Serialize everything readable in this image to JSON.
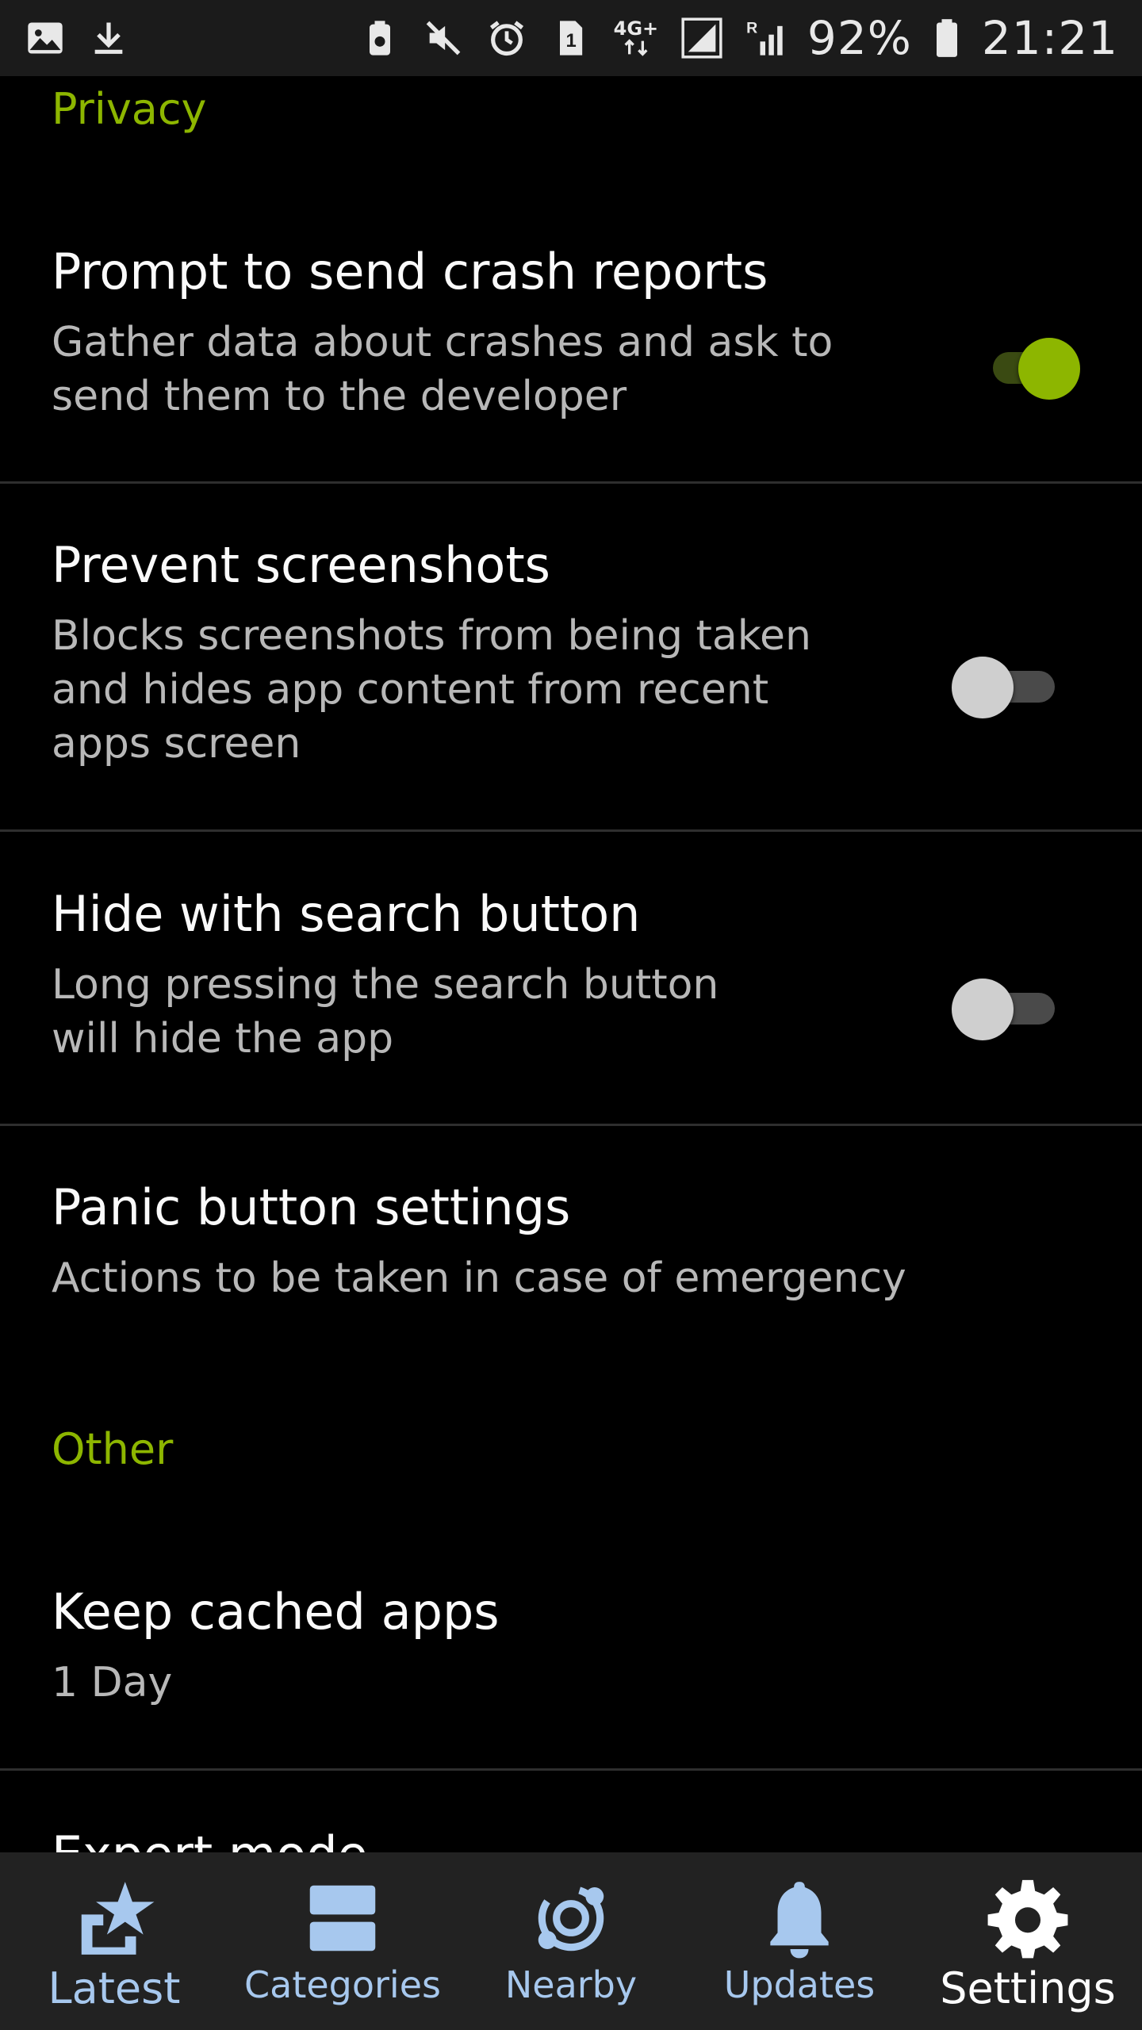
{
  "status_bar": {
    "battery_percent": "92%",
    "time": "21:21",
    "sim_number": "1",
    "network_type": "4G+",
    "roaming": "R",
    "icons": [
      "image-icon",
      "download-icon",
      "battery-saver-icon",
      "mute-icon",
      "alarm-icon",
      "sim-icon",
      "data-arrows-icon",
      "signal-icon",
      "signal-roaming-icon",
      "battery-icon"
    ]
  },
  "sections": {
    "privacy": {
      "header": "Privacy"
    },
    "other": {
      "header": "Other"
    }
  },
  "prefs": {
    "crash_reports": {
      "title": "Prompt to send crash reports",
      "summary": "Gather data about crashes and ask to\nsend them to the developer",
      "enabled": true
    },
    "prevent_screenshots": {
      "title": "Prevent screenshots",
      "summary": "Blocks screenshots from being taken\nand hides app content from recent\napps screen",
      "enabled": false
    },
    "hide_search": {
      "title": "Hide with search button",
      "summary": "Long pressing the search button\nwill hide the app",
      "enabled": false
    },
    "panic": {
      "title": "Panic button settings",
      "summary": "Actions to be taken in case of emergency"
    },
    "cached_apps": {
      "title": "Keep cached apps",
      "summary": "1 Day"
    },
    "expert_mode": {
      "title": "Expert mode"
    }
  },
  "bottom_nav": {
    "items": [
      {
        "label": "Latest",
        "icon": "latest-star-icon"
      },
      {
        "label": "Categories",
        "icon": "categories-icon"
      },
      {
        "label": "Nearby",
        "icon": "nearby-icon"
      },
      {
        "label": "Updates",
        "icon": "bell-icon"
      },
      {
        "label": "Settings",
        "icon": "gear-icon",
        "active": true
      }
    ]
  },
  "colors": {
    "accent": "#8db600",
    "nav_inactive": "#a7c8ee",
    "nav_active": "#ffffff",
    "background": "#000000"
  }
}
